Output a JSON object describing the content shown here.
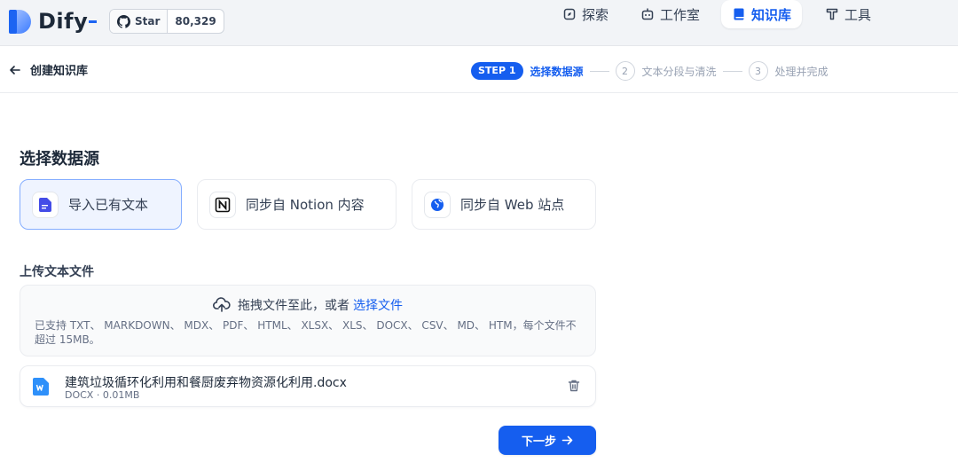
{
  "app": {
    "brand": "Dify",
    "github": {
      "star_label": "Star",
      "star_count": "80,329"
    }
  },
  "nav": {
    "items": [
      {
        "label": "探索",
        "icon": "compass-icon",
        "active": false
      },
      {
        "label": "工作室",
        "icon": "robot-icon",
        "active": false
      },
      {
        "label": "知识库",
        "icon": "book-icon",
        "active": true
      },
      {
        "label": "工具",
        "icon": "hammer-icon",
        "active": false
      }
    ]
  },
  "subheader": {
    "back_label": "创建知识库",
    "steps": [
      {
        "badge": "STEP 1",
        "label": "选择数据源",
        "active": true
      },
      {
        "number": "2",
        "label": "文本分段与清洗",
        "active": false
      },
      {
        "number": "3",
        "label": "处理并完成",
        "active": false
      }
    ]
  },
  "main": {
    "title": "选择数据源",
    "sources": [
      {
        "label": "导入已有文本",
        "icon": "file-text-icon",
        "active": true
      },
      {
        "label": "同步自 Notion 内容",
        "icon": "notion-icon",
        "active": false
      },
      {
        "label": "同步自 Web 站点",
        "icon": "globe-icon",
        "active": false
      }
    ],
    "upload": {
      "title": "上传文本文件",
      "drop_text": "拖拽文件至此，或者",
      "drop_link": "选择文件",
      "hint": "已支持 TXT、 MARKDOWN、 MDX、 PDF、 HTML、 XLSX、 XLS、 DOCX、 CSV、 MD、 HTM，每个文件不超过 15MB。"
    },
    "files": [
      {
        "name": "建筑垃圾循环化利用和餐厨废弃物资源化利用.docx",
        "meta": "DOCX · 0.01MB"
      }
    ],
    "next_label": "下一步"
  },
  "colors": {
    "primary": "#155eef",
    "active_card_bg": "#eff4ff",
    "topbar_bg": "#f2f4f7"
  }
}
